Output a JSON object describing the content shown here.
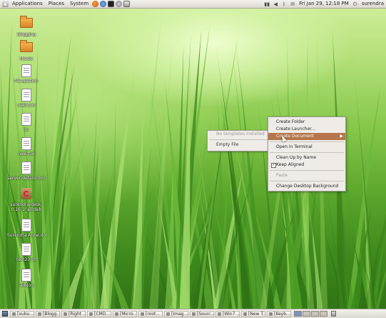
{
  "top_panel": {
    "menus": [
      "Applications",
      "Places",
      "System"
    ],
    "clock": "Fri Jan 29, 12:18 PM",
    "user": "surendra"
  },
  "desktop_icons": [
    {
      "label": "Blogging",
      "type": "folder"
    },
    {
      "label": "thesis",
      "type": "folder"
    },
    {
      "label": "file.gestion",
      "type": "doc"
    },
    {
      "label": "dekh.txt",
      "type": "doc"
    },
    {
      "label": "ip",
      "type": "doc"
    },
    {
      "label": "new file",
      "type": "doc"
    },
    {
      "label": "server details.doc",
      "type": "doc"
    },
    {
      "label": "surendra-desk-0.16-1_all.deb",
      "type": "deb"
    },
    {
      "label": "Surendra Anne.doc",
      "type": "doc"
    },
    {
      "label": "test23.sh",
      "type": "doc"
    },
    {
      "label": "ToBlog",
      "type": "doc"
    }
  ],
  "context_menu": {
    "items": [
      {
        "label": "Create Folder"
      },
      {
        "label": "Create Launcher..."
      },
      {
        "label": "Create Document"
      },
      {
        "label": "Open in Terminal"
      },
      {
        "label": "Clean Up by Name"
      },
      {
        "label": "Keep Aligned"
      },
      {
        "label": "Paste"
      },
      {
        "label": "Change Desktop Background"
      }
    ]
  },
  "submenu": {
    "items": [
      {
        "label": "No templates installed"
      },
      {
        "label": "Empty File"
      }
    ]
  },
  "taskbar": {
    "tasks": [
      "[xubu...",
      "[Blogg...",
      "[Right ...",
      "[CMD...",
      "[Micro...",
      "[root...",
      "[Imag...",
      "[Sourc...",
      "[Win7 ...",
      "[New T...",
      "[Keyb..."
    ]
  },
  "colors": {
    "menu_highlight": "#b4764a",
    "panel_bg": "#e6e2da",
    "grass": "#5aa52b"
  }
}
